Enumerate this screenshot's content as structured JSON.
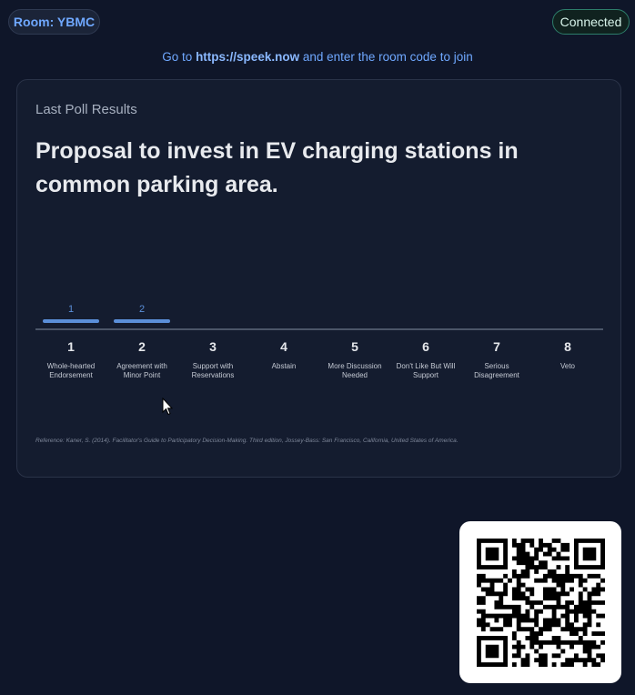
{
  "header": {
    "room_label": "Room: YBMC",
    "status": "Connected",
    "join": {
      "prefix": "Go to",
      "url": "https://speek.now",
      "suffix": "and enter the room code to join"
    }
  },
  "card": {
    "label": "Last Poll Results",
    "question": "Proposal to invest in EV charging stations in common parking area.",
    "reference": "Reference: Kaner, S. (2014). Facilitator's Guide to Participatory Decision-Making. Third edition, Jossey-Bass: San Francisco, California, United States of America."
  },
  "colors": {
    "accent": "#5b8fd9",
    "bar": "#5b8fd9",
    "status_border": "#2d7d6a",
    "background": "#0f1629"
  },
  "icons": {
    "cursor": "mouse-pointer-icon",
    "qr": "qr-code"
  },
  "chart_data": {
    "type": "bar",
    "categories": [
      "1",
      "2",
      "3",
      "4",
      "5",
      "6",
      "7",
      "8"
    ],
    "category_labels": [
      [
        "Whole-hearted",
        "Endorsement"
      ],
      [
        "Agreement with",
        "Minor Point"
      ],
      [
        "Support with",
        "Reservations"
      ],
      [
        "Abstain"
      ],
      [
        "More Discussion",
        "Needed"
      ],
      [
        "Don't Like But Will",
        "Support"
      ],
      [
        "Serious",
        "Disagreement"
      ],
      [
        "Veto"
      ]
    ],
    "values": [
      1,
      2,
      0,
      0,
      0,
      0,
      0,
      0
    ],
    "data_labels": [
      "1",
      "2",
      "",
      "",
      "",
      "",
      "",
      ""
    ],
    "ylim": [
      0,
      80
    ],
    "grid": false
  }
}
